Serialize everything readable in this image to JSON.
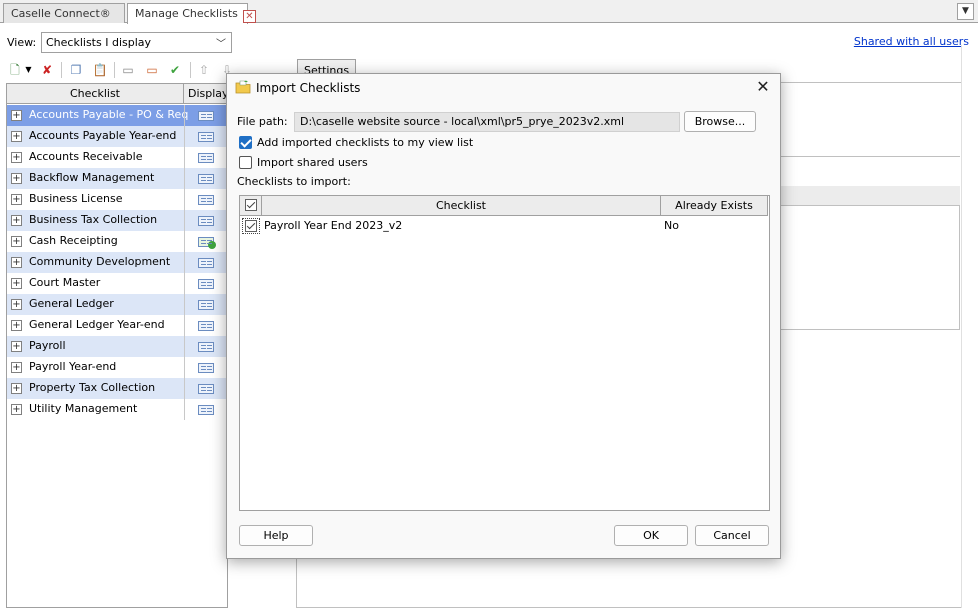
{
  "tabs": [
    {
      "label": "Caselle Connect®"
    },
    {
      "label": "Manage Checklists"
    }
  ],
  "view": {
    "label": "View:",
    "selected": "Checklists I display",
    "shared_link": "Shared with all users"
  },
  "toolbar": {
    "settings_tab": "Settings"
  },
  "grid": {
    "columns": [
      "Checklist",
      "Display"
    ],
    "rows": [
      {
        "label": "Accounts Payable - PO & Req"
      },
      {
        "label": "Accounts Payable Year-end"
      },
      {
        "label": "Accounts Receivable"
      },
      {
        "label": "Backflow Management"
      },
      {
        "label": "Business License"
      },
      {
        "label": "Business Tax Collection"
      },
      {
        "label": "Cash Receipting"
      },
      {
        "label": "Community Development"
      },
      {
        "label": "Court Master"
      },
      {
        "label": "General Ledger"
      },
      {
        "label": "General Ledger Year-end"
      },
      {
        "label": "Payroll"
      },
      {
        "label": "Payroll Year-end"
      },
      {
        "label": "Property Tax Collection"
      },
      {
        "label": "Utility Management"
      }
    ]
  },
  "dialog": {
    "title": "Import Checklists",
    "file_path_label": "File path:",
    "file_path_value": "D:\\caselle website source - local\\xml\\pr5_prye_2023v2.xml",
    "browse_label": "Browse...",
    "add_imported_label": "Add imported checklists to my view list",
    "add_imported_checked": true,
    "import_shared_label": "Import shared users",
    "import_shared_checked": false,
    "checklists_to_import_label": "Checklists to import:",
    "columns": {
      "checklist": "Checklist",
      "exists": "Already Exists"
    },
    "rows": [
      {
        "checklist": "Payroll Year End 2023_v2",
        "exists": "No",
        "checked": true
      }
    ],
    "help_label": "Help",
    "ok_label": "OK",
    "cancel_label": "Cancel"
  }
}
